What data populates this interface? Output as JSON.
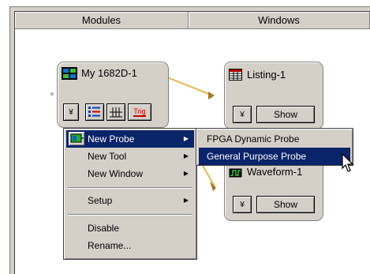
{
  "header": {
    "modules": "Modules",
    "windows": "Windows"
  },
  "module_card": {
    "title": "My 1682D-1",
    "trig_label": "Trig",
    "dropdown_glyph": "¥"
  },
  "listing_card": {
    "title": "Listing-1",
    "dropdown_glyph": "¥",
    "show_label": "Show"
  },
  "waveform_card": {
    "title": "Waveform-1",
    "dropdown_glyph": "¥",
    "show_label": "Show"
  },
  "context_menu": {
    "items": [
      {
        "label": "New Probe",
        "submenu": true,
        "selected": true
      },
      {
        "label": "New Tool",
        "submenu": true
      },
      {
        "label": "New Window",
        "submenu": true
      },
      {
        "label": "Setup",
        "submenu": true
      },
      {
        "label": "Disable"
      },
      {
        "label": "Rename..."
      }
    ]
  },
  "submenu": {
    "items": [
      {
        "label": "FPGA Dynamic Probe"
      },
      {
        "label": "General Purpose Probe",
        "selected": true
      }
    ]
  },
  "colors": {
    "selection": "#0a246a",
    "connector": "#e8b44a",
    "face": "#d4d0c8",
    "trig_red": "#cc0000"
  }
}
